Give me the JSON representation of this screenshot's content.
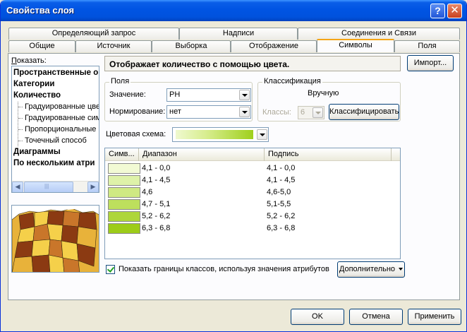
{
  "window": {
    "title": "Свойства слоя",
    "help_glyph": "?",
    "close_glyph": "✕"
  },
  "tabs_row1": [
    {
      "label": "Определяющий запрос"
    },
    {
      "label": "Надписи"
    },
    {
      "label": "Соединения и Связи"
    }
  ],
  "tabs_row2": [
    {
      "label": "Общие"
    },
    {
      "label": "Источник"
    },
    {
      "label": "Выборка"
    },
    {
      "label": "Отображение"
    },
    {
      "label": "Символы",
      "active": true
    },
    {
      "label": "Поля"
    }
  ],
  "show_panel": {
    "label_prefix": "П",
    "label_rest": "оказать:",
    "tree": [
      {
        "label": "Пространственные о",
        "level": 0
      },
      {
        "label": "Категории",
        "level": 0
      },
      {
        "label": "Количество",
        "level": 0
      },
      {
        "label": "Градуированные цве",
        "level": 1
      },
      {
        "label": "Градуированные сим",
        "level": 1
      },
      {
        "label": "Пропорциональные",
        "level": 1
      },
      {
        "label": "Точечный способ",
        "level": 1
      },
      {
        "label": "Диаграммы",
        "level": 0
      },
      {
        "label": "По нескольким атри",
        "level": 0
      }
    ],
    "scroll_left": "◀",
    "scroll_right": "▶",
    "scroll_grip": "|||"
  },
  "description": "Отображает количество с помощью цвета.",
  "import_button": "Импорт...",
  "fields_group": {
    "title": "Поля",
    "value_label": "Значение:",
    "value": "PH",
    "normalize_label": "Нормирование:",
    "normalize": "нет"
  },
  "classification_group": {
    "title": "Классификация",
    "method": "Вручную",
    "classes_label": "Классы:",
    "classes": "6",
    "classify_button": "Классифицировать"
  },
  "color_scheme": {
    "label": "Цветовая схема:"
  },
  "class_table": {
    "headers": [
      "Симв...",
      "Диапазон",
      "Подпись"
    ],
    "rows": [
      {
        "color": "#f2fad4",
        "range": "4,1 - 0,0",
        "label": "4,1 - 0,0"
      },
      {
        "color": "#def2a9",
        "range": "4,1 - 4,5",
        "label": "4,1 - 4,5"
      },
      {
        "color": "#cfe983",
        "range": "4,6",
        "label": "4,6-5,0"
      },
      {
        "color": "#bddf5d",
        "range": "4,7 - 5,1",
        "label": "5,1-5,5"
      },
      {
        "color": "#aed63a",
        "range": "5,2 - 6,2",
        "label": "5,2 - 6,2"
      },
      {
        "color": "#9dcc19",
        "range": "6,3 - 6,8",
        "label": "6,3 - 6,8"
      }
    ]
  },
  "show_bounds": {
    "checked": true,
    "label": "Показать границы классов, используя значения атрибутов"
  },
  "advanced_button": "Дополнительно",
  "footer": {
    "ok": "OK",
    "cancel": "Отмена",
    "apply": "Применить"
  }
}
